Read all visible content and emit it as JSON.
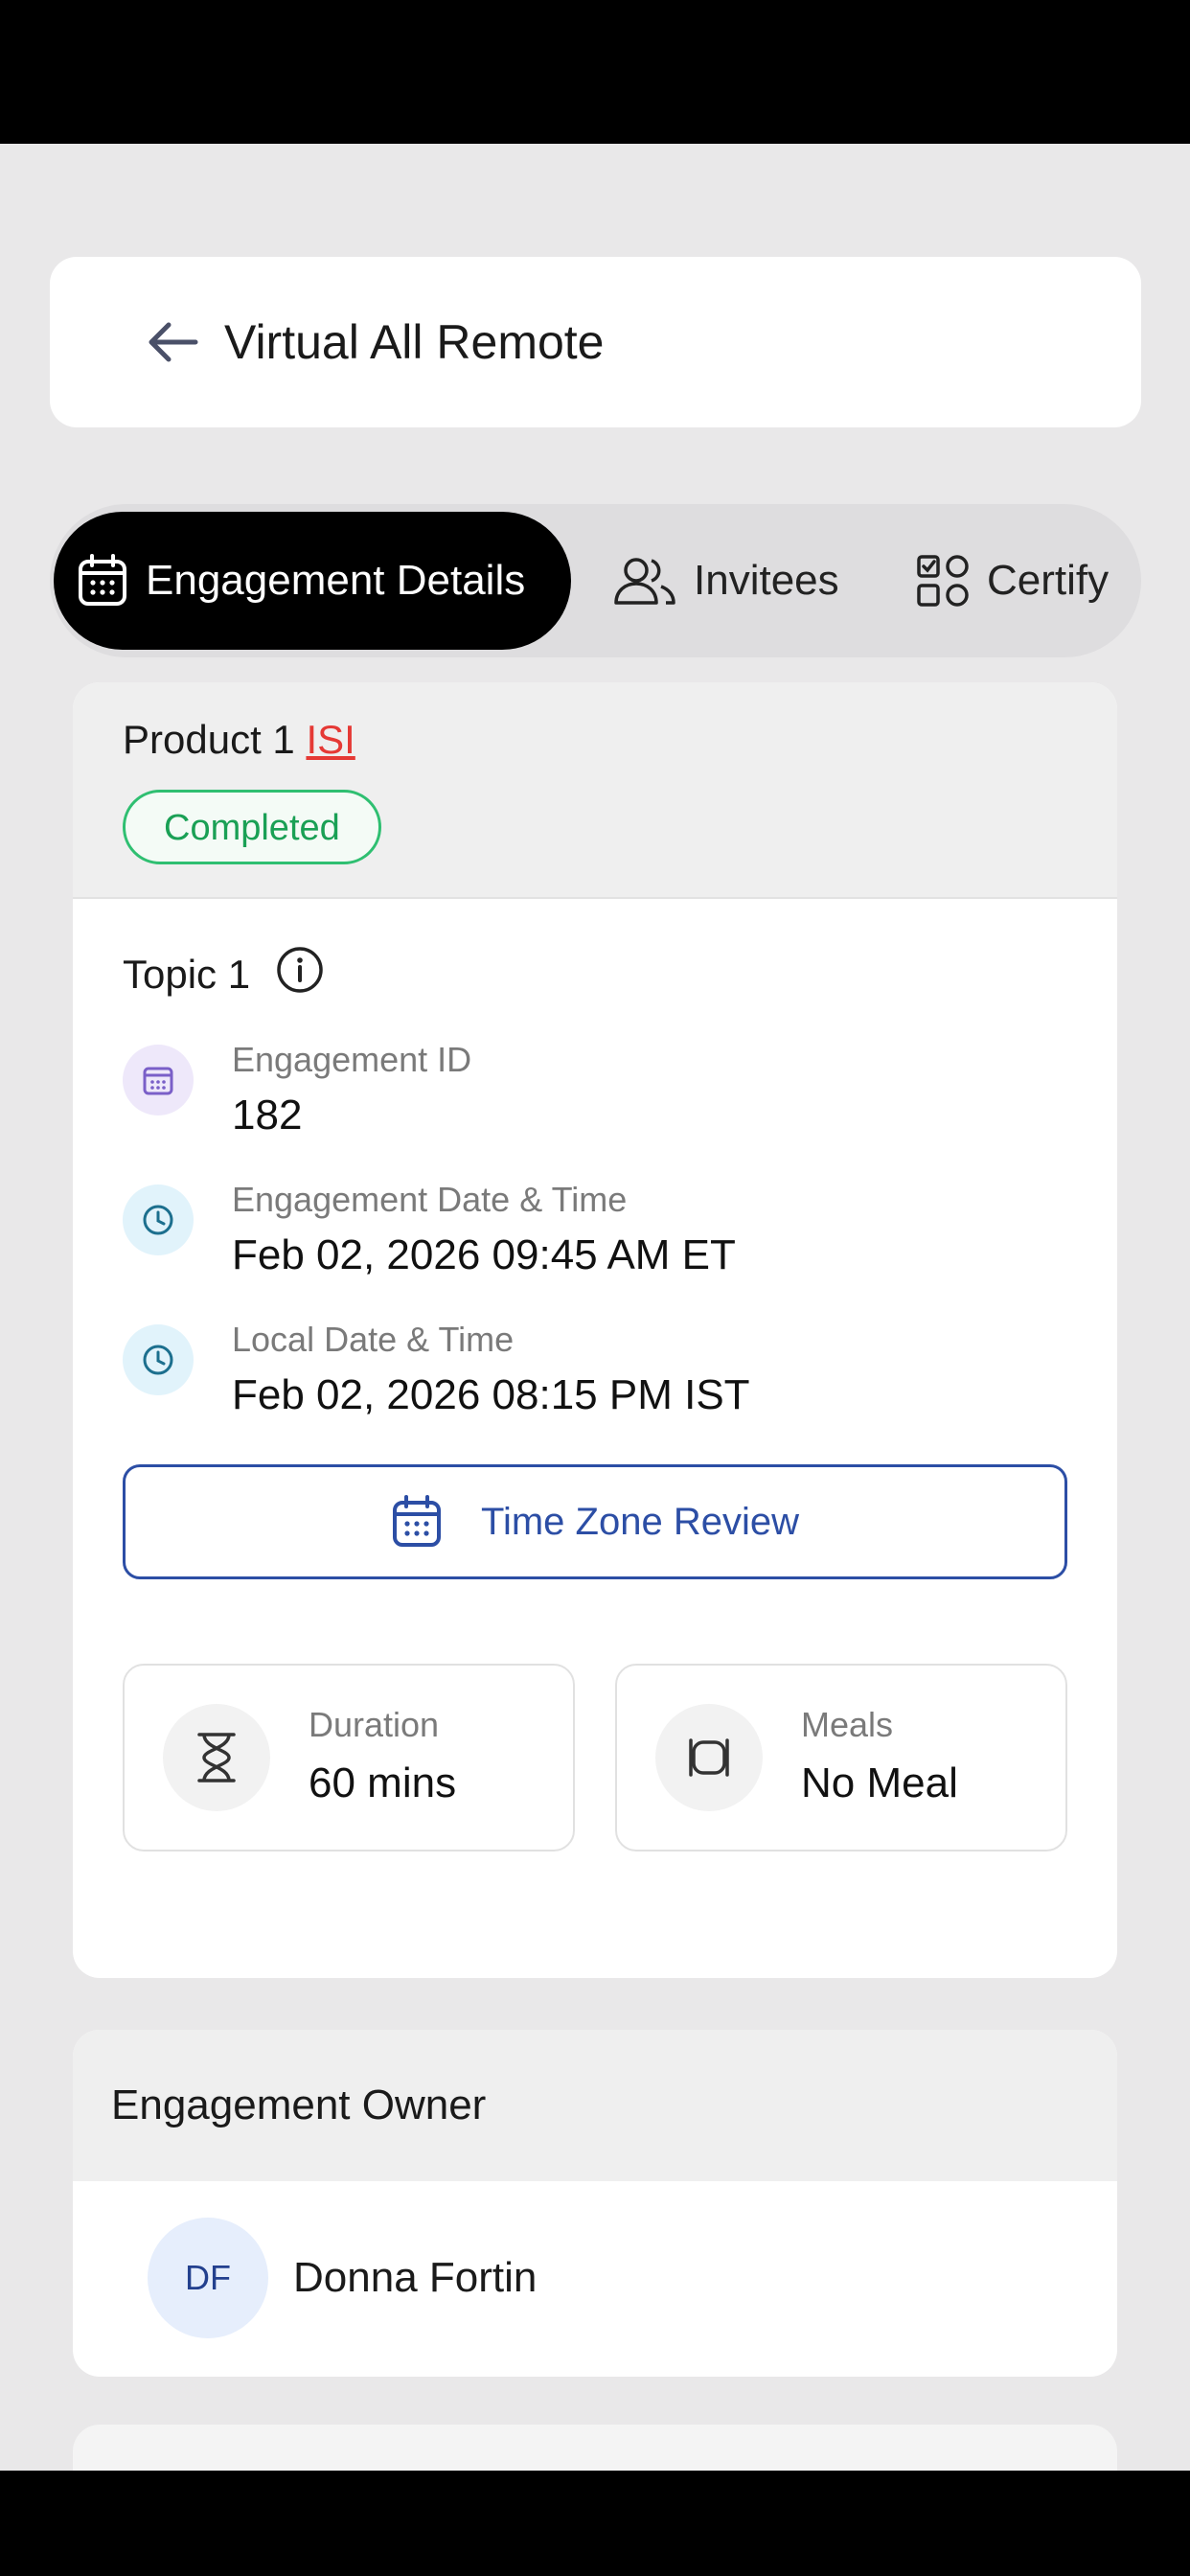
{
  "header": {
    "title": "Virtual All Remote"
  },
  "tabs": [
    {
      "label": "Engagement Details",
      "icon": "calendar-icon",
      "active": true
    },
    {
      "label": "Invitees",
      "icon": "users-icon",
      "active": false
    },
    {
      "label": "Certify",
      "icon": "checklist-icon",
      "active": false
    }
  ],
  "engagement": {
    "product": "Product 1",
    "isi_label": "ISI",
    "status": "Completed",
    "topic": "Topic 1",
    "fields": [
      {
        "label": "Engagement ID",
        "value": "182",
        "icon": "calendar-icon"
      },
      {
        "label": "Engagement Date & Time",
        "value": "Feb 02, 2026 09:45 AM ET",
        "icon": "clock-icon"
      },
      {
        "label": "Local Date & Time",
        "value": "Feb 02, 2026 08:15 PM IST",
        "icon": "clock-icon"
      }
    ],
    "time_zone_button": "Time Zone Review",
    "duration": {
      "label": "Duration",
      "value": "60 mins",
      "icon": "hourglass-icon"
    },
    "meals": {
      "label": "Meals",
      "value": "No Meal",
      "icon": "plate-icon"
    }
  },
  "owner": {
    "heading": "Engagement Owner",
    "initials": "DF",
    "name": "Donna Fortin"
  },
  "colors": {
    "active_tab_bg": "#000000",
    "status_green": "#2fbf71",
    "link_red": "#e53935",
    "button_blue": "#2c4ea5"
  }
}
